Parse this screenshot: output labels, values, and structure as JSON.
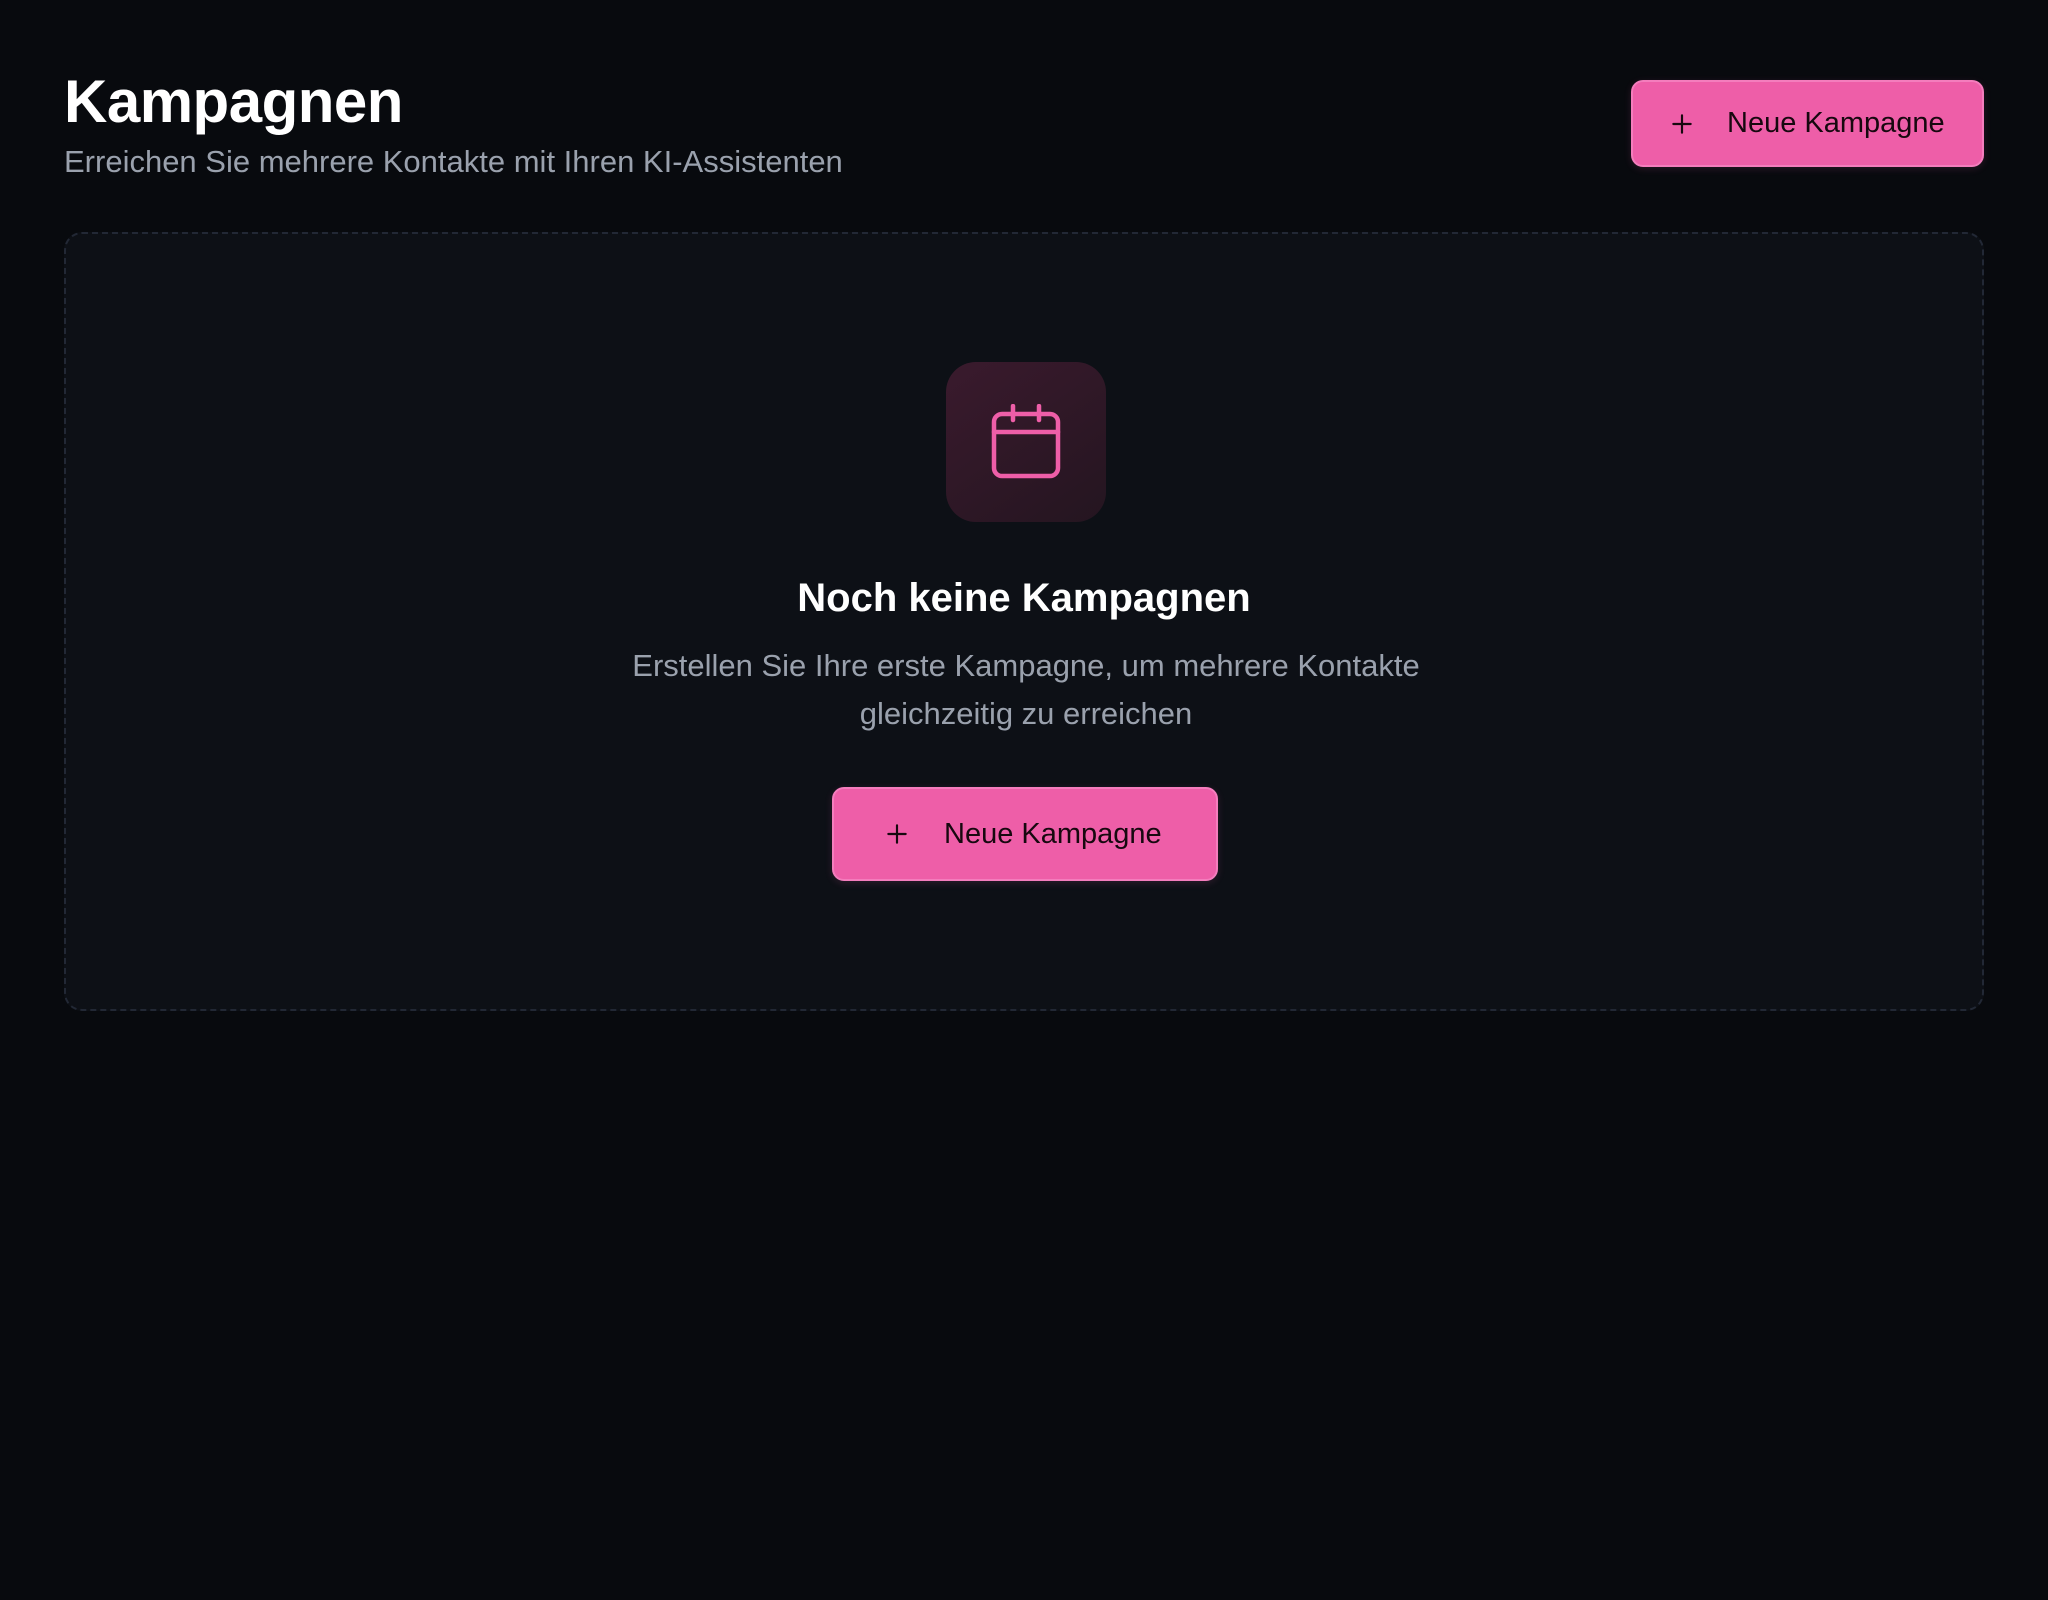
{
  "header": {
    "title": "Kampagnen",
    "subtitle": "Erreichen Sie mehrere Kontakte mit Ihren KI-Assistenten",
    "new_button_label": "Neue Kampagne",
    "new_button_icon": "plus-icon"
  },
  "empty_state": {
    "icon": "calendar-icon",
    "title": "Noch keine Kampagnen",
    "description": "Erstellen Sie Ihre erste Kampagne, um mehrere Kontakte gleichzeitig zu erreichen",
    "button_label": "Neue Kampagne",
    "button_icon": "plus-icon"
  },
  "colors": {
    "background": "#080a0e",
    "card_background": "#0d1016",
    "accent": "#ee5ea8",
    "text_primary": "#ffffff",
    "text_muted": "#9aa1ad"
  }
}
